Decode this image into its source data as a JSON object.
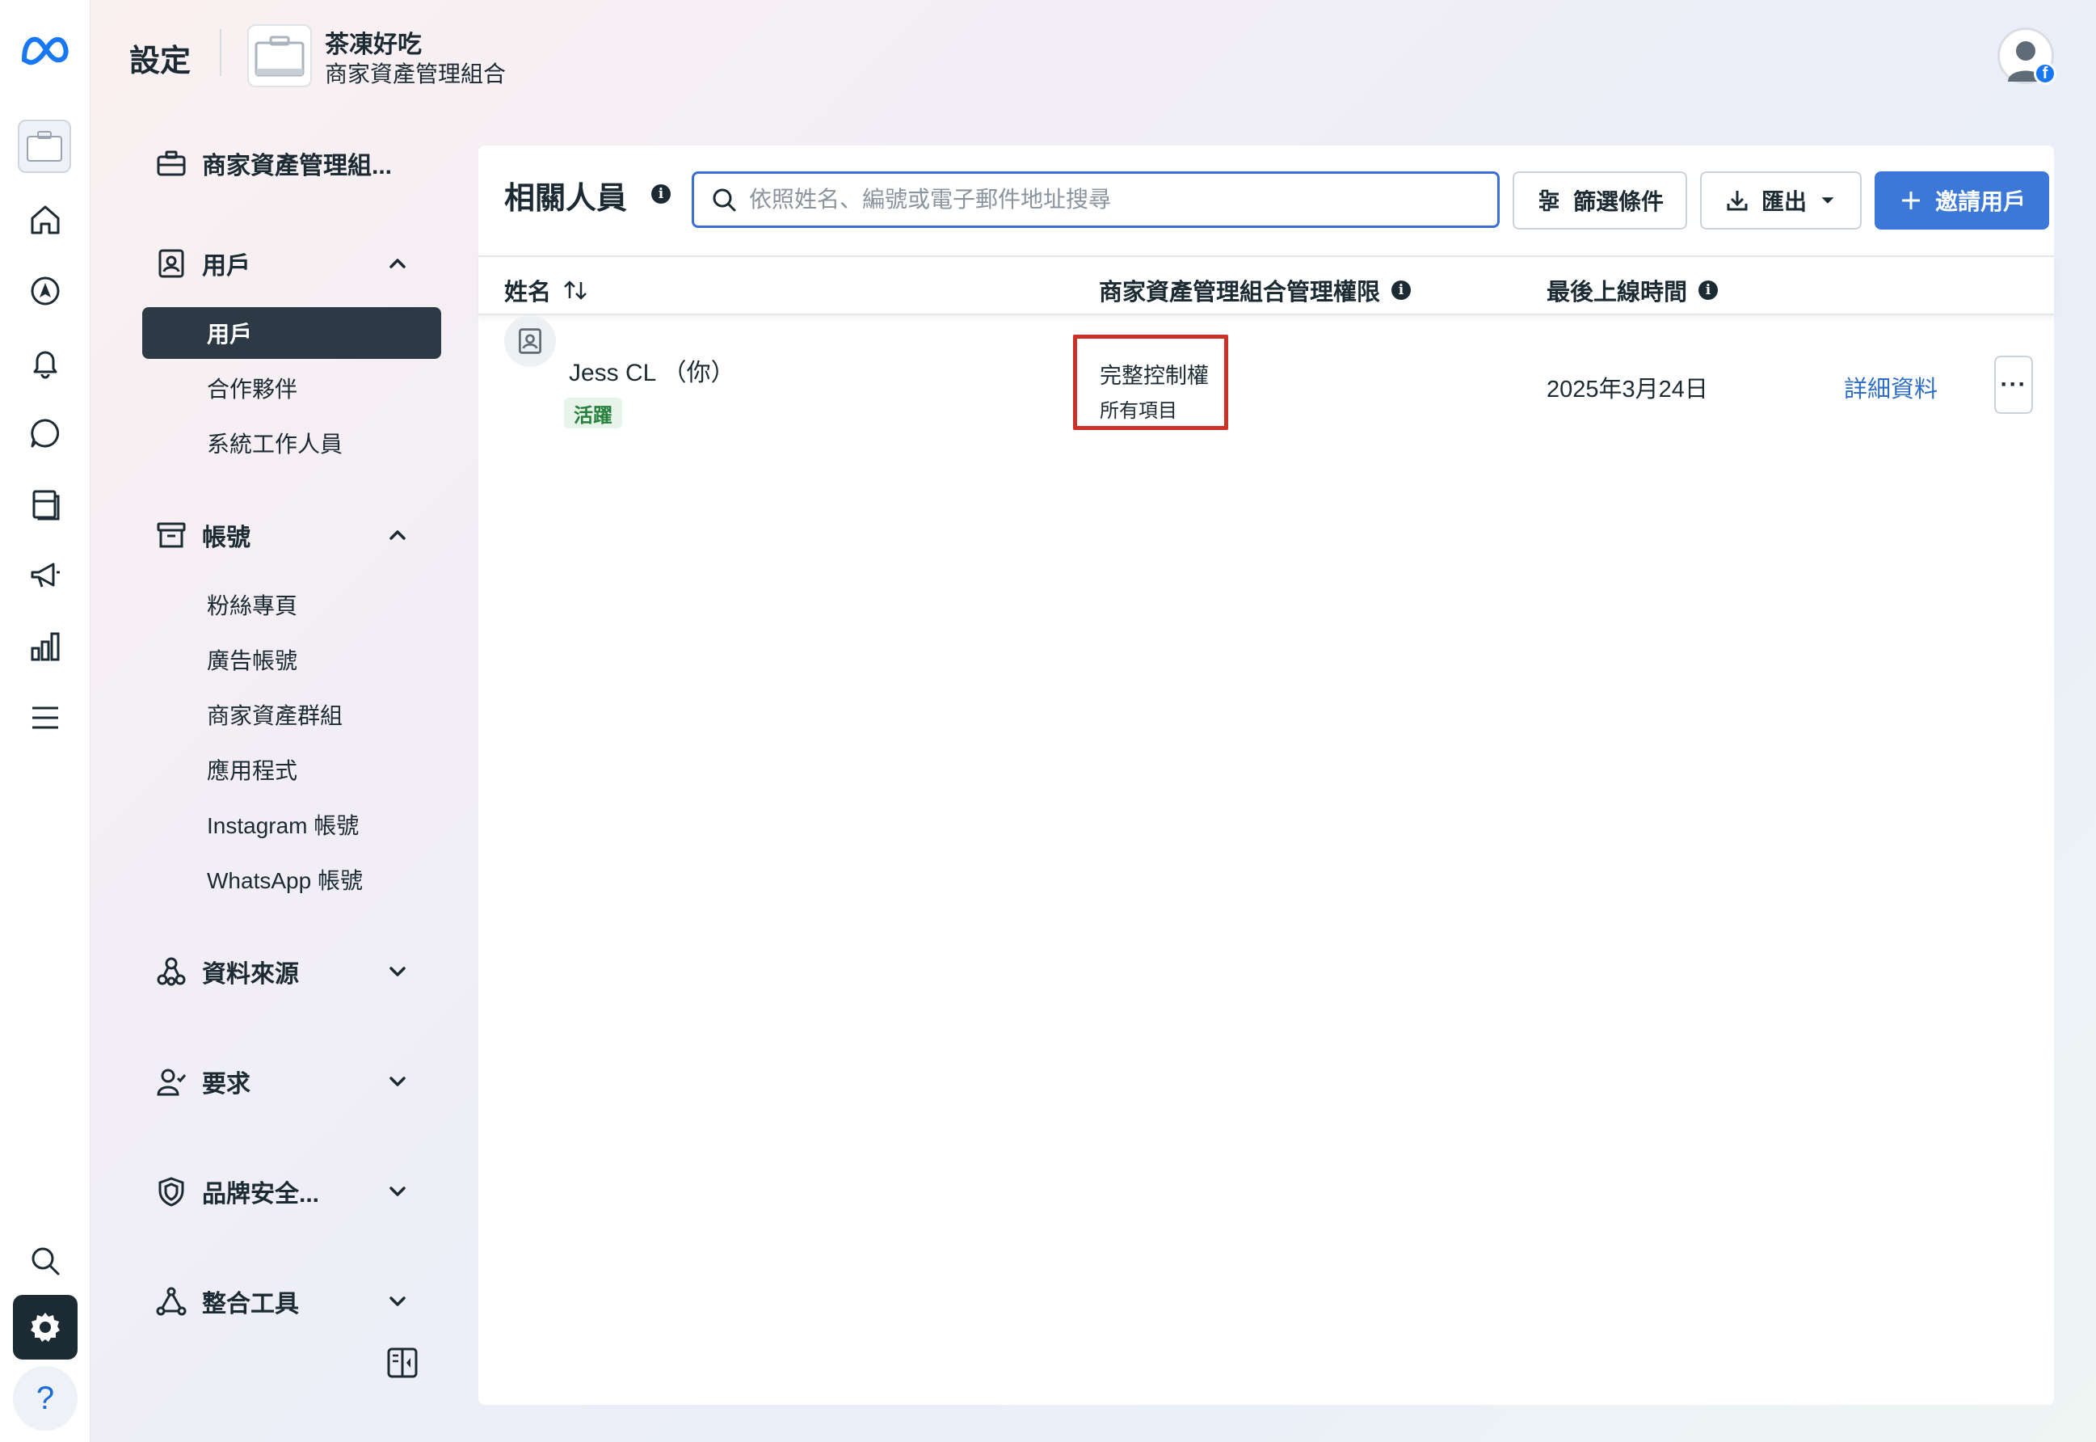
{
  "header": {
    "title": "設定",
    "business_name": "茶凍好吃",
    "business_type": "商家資產管理組合"
  },
  "nav": {
    "business_item": "商家資產管理組...",
    "users_section": "用戶",
    "users_items": [
      "用戶",
      "合作夥伴",
      "系統工作人員"
    ],
    "accounts_section": "帳號",
    "accounts_items": [
      "粉絲專頁",
      "廣告帳號",
      "商家資產群組",
      "應用程式",
      "Instagram 帳號",
      "WhatsApp 帳號"
    ],
    "data_sources": "資料來源",
    "requests": "要求",
    "brand_safety": "品牌安全...",
    "integrations": "整合工具"
  },
  "main": {
    "title": "相關人員",
    "search_placeholder": "依照姓名、編號或電子郵件地址搜尋",
    "filter_button": "篩選條件",
    "export_button": "匯出",
    "invite_button": "邀請用戶",
    "columns": {
      "name": "姓名",
      "permission": "商家資產管理組合管理權限",
      "last_online": "最後上線時間"
    },
    "rows": [
      {
        "name": "Jess CL （你）",
        "status": "活躍",
        "permission": "完整控制權",
        "permission_scope": "所有項目",
        "last_online": "2025年3月24日",
        "details": "詳細資料",
        "more": "···"
      }
    ]
  },
  "rail": {
    "help": "?"
  },
  "colors": {
    "accent": "#3b78d8",
    "highlight_border": "#cc3128",
    "active_badge": "#26803c",
    "link": "#2f6ec7"
  }
}
